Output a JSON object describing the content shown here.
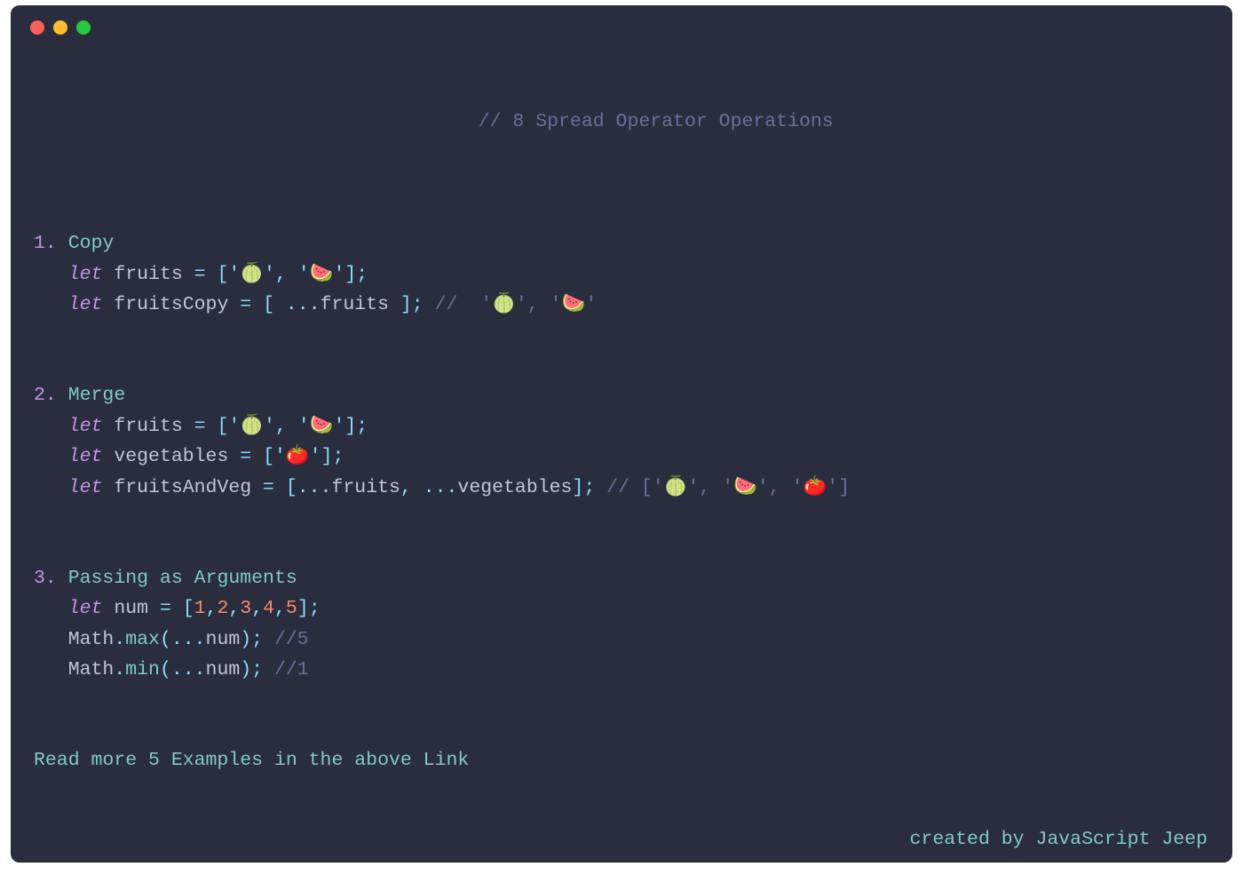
{
  "title_comment": "// 8 Spread Operator Operations",
  "sections": {
    "s1": {
      "num": "1.",
      "heading": "Copy",
      "line1": {
        "let": "let",
        "var": "fruits",
        "eq": " = [",
        "q1": "'",
        "e1": "🍈",
        "q2": "'",
        "comma": ", ",
        "q3": "'",
        "e2": "🍉",
        "q4": "'",
        "close": "];"
      },
      "line2": {
        "let": "let",
        "var": "fruitsCopy",
        "eq": " = [ ...",
        "ref": "fruits",
        "close": " ];",
        "comment_pre": " //  ",
        "cq1": "'",
        "ce1": "🍈",
        "cq2": "'",
        "ccomma": ", ",
        "cq3": "'",
        "ce2": "🍉",
        "cq4": "'"
      }
    },
    "s2": {
      "num": "2.",
      "heading": "Merge",
      "line1": {
        "let": "let",
        "var": "fruits",
        "eq": " = [",
        "q1": "'",
        "e1": "🍈",
        "q2": "'",
        "comma": ", ",
        "q3": "'",
        "e2": "🍉",
        "q4": "'",
        "close": "];"
      },
      "line2": {
        "let": "let",
        "var": "vegetables",
        "eq": " = [",
        "q1": "'",
        "e1": "🍅",
        "q2": "'",
        "close": "];"
      },
      "line3": {
        "let": "let",
        "var": "fruitsAndVeg",
        "eq": " = [...",
        "ref1": "fruits",
        "comma1": ", ...",
        "ref2": "vegetables",
        "close": "];",
        "comment_pre": " // [",
        "cq1": "'",
        "ce1": "🍈",
        "cq2": "'",
        "cc1": ", ",
        "cq3": "'",
        "ce2": "🍉",
        "cq4": "'",
        "cc2": ", ",
        "cq5": "'",
        "ce3": "🍅",
        "cq6": "'",
        "cend": "]"
      }
    },
    "s3": {
      "num": "3.",
      "heading": "Passing as Arguments",
      "line1": {
        "let": "let",
        "var": "num",
        "eq": " = [",
        "n1": "1",
        "c1": ",",
        "n2": "2",
        "c2": ",",
        "n3": "3",
        "c3": ",",
        "n4": "4",
        "c4": ",",
        "n5": "5",
        "close": "];"
      },
      "line2": {
        "obj": "Math",
        "dot": ".",
        "fn": "max",
        "open": "(...",
        "ref": "num",
        "close": ");",
        "comment": " //5"
      },
      "line3": {
        "obj": "Math",
        "dot": ".",
        "fn": "min",
        "open": "(...",
        "ref": "num",
        "close": ");",
        "comment": " //1"
      }
    }
  },
  "readmore": "Read more 5 Examples in the above Link",
  "footer": "created by JavaScript Jeep"
}
